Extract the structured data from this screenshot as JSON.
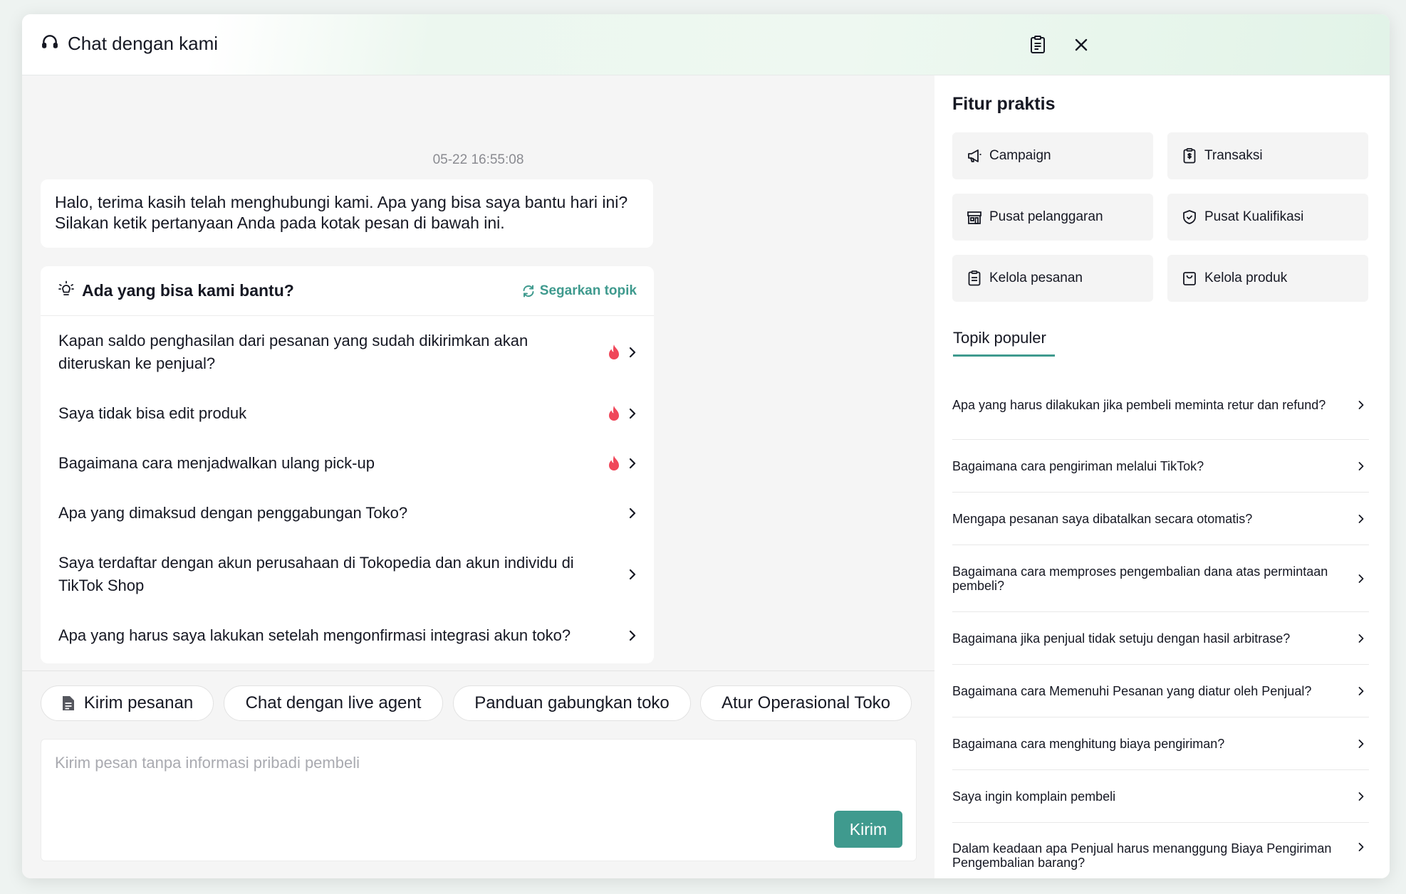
{
  "header": {
    "title": "Chat dengan kami"
  },
  "chat": {
    "clipped_text": "' ' ' ' ' ' '",
    "timestamp": "05-22 16:55:08",
    "greeting": "Halo, terima kasih telah menghubungi kami. Apa yang bisa saya bantu hari ini? Silakan ketik pertanyaan Anda pada kotak pesan di bawah ini.",
    "help_title": "Ada yang bisa kami bantu?",
    "refresh_label": "Segarkan topik",
    "questions": [
      {
        "text": "Kapan saldo penghasilan dari pesanan yang sudah dikirimkan akan diteruskan ke penjual?",
        "hot": true
      },
      {
        "text": "Saya tidak bisa edit produk",
        "hot": true
      },
      {
        "text": "Bagaimana cara menjadwalkan ulang pick-up",
        "hot": true
      },
      {
        "text": "Apa yang dimaksud dengan penggabungan Toko?",
        "hot": false
      },
      {
        "text": "Saya terdaftar dengan akun perusahaan di Tokopedia dan akun individu di TikTok Shop",
        "hot": false
      },
      {
        "text": "Apa yang harus saya lakukan setelah mengonfirmasi integrasi akun toko?",
        "hot": false
      }
    ]
  },
  "quick_actions": [
    {
      "label": "Kirim pesanan",
      "icon": "document-icon"
    },
    {
      "label": "Chat dengan live agent"
    },
    {
      "label": "Panduan gabungkan toko"
    },
    {
      "label": "Atur Operasional Toko"
    }
  ],
  "composer": {
    "placeholder": "Kirim pesan tanpa informasi pribadi pembeli",
    "send_label": "Kirim"
  },
  "side": {
    "features_title": "Fitur praktis",
    "features": [
      {
        "label": "Campaign",
        "icon": "megaphone-icon"
      },
      {
        "label": "Transaksi",
        "icon": "transaction-icon"
      },
      {
        "label": "Pusat pelanggaran",
        "icon": "store-icon"
      },
      {
        "label": "Pusat Kualifikasi",
        "icon": "shield-icon"
      },
      {
        "label": "Kelola pesanan",
        "icon": "clipboard-icon"
      },
      {
        "label": "Kelola produk",
        "icon": "bag-icon"
      }
    ],
    "topics_tab": "Topik populer",
    "topics": [
      "Apa yang harus dilakukan jika pembeli meminta retur dan refund?",
      "Bagaimana cara pengiriman melalui TikTok?",
      "Mengapa pesanan saya dibatalkan secara otomatis?",
      "Bagaimana cara memproses pengembalian dana atas permintaan pembeli?",
      "Bagaimana jika penjual tidak setuju dengan hasil arbitrase?",
      "Bagaimana cara Memenuhi Pesanan yang diatur oleh Penjual?",
      "Bagaimana cara menghitung biaya pengiriman?",
      "Saya ingin komplain pembeli",
      "Dalam keadaan apa Penjual harus menanggung Biaya Pengiriman Pengembalian barang?"
    ]
  },
  "colors": {
    "accent": "#3f9a8e",
    "hot": "#f0475a",
    "panel": "#f5f5f5",
    "feature_bg": "#f4f4f4"
  }
}
